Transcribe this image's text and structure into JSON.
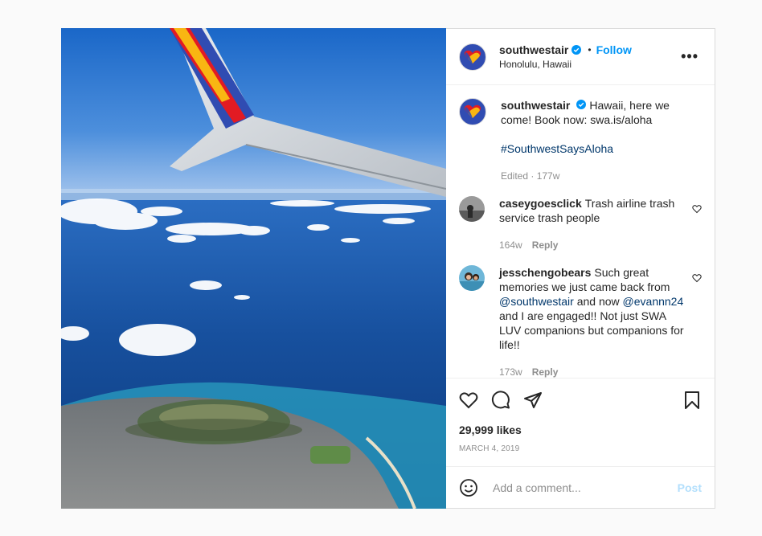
{
  "post": {
    "username": "southwestair",
    "follow_label": "Follow",
    "location": "Honolulu, Hawaii",
    "more_label": "•••"
  },
  "caption": {
    "username": "southwestair",
    "text": "Hawaii, here we come! Book now: swa.is/aloha",
    "hashtag": "#SouthwestSaysAloha",
    "meta": "Edited · 177w"
  },
  "comments": [
    {
      "username": "caseygoesclick",
      "text": "Trash airline trash service trash people",
      "age": "164w",
      "reply_label": "Reply"
    },
    {
      "username": "jesschengobears",
      "text_1": "Such great memories we just came back from",
      "mention_1": "@southwestair",
      "text_2": "and now",
      "mention_2": "@evannn24",
      "text_3": "and I are engaged!! Not just SWA LUV companions but companions for life!!",
      "age": "173w",
      "reply_label": "Reply"
    }
  ],
  "likes": "29,999 likes",
  "date": "MARCH 4, 2019",
  "add_comment": {
    "placeholder": "Add a comment...",
    "post_label": "Post"
  },
  "colors": {
    "brand_blue": "#304cb2",
    "brand_red": "#e21b23",
    "brand_yellow": "#f9b612",
    "link": "#00376b",
    "follow": "#0095f6"
  },
  "icons": [
    "verified-badge-icon",
    "more-icon",
    "heart-icon",
    "comment-icon",
    "share-icon",
    "bookmark-icon",
    "emoji-icon"
  ]
}
